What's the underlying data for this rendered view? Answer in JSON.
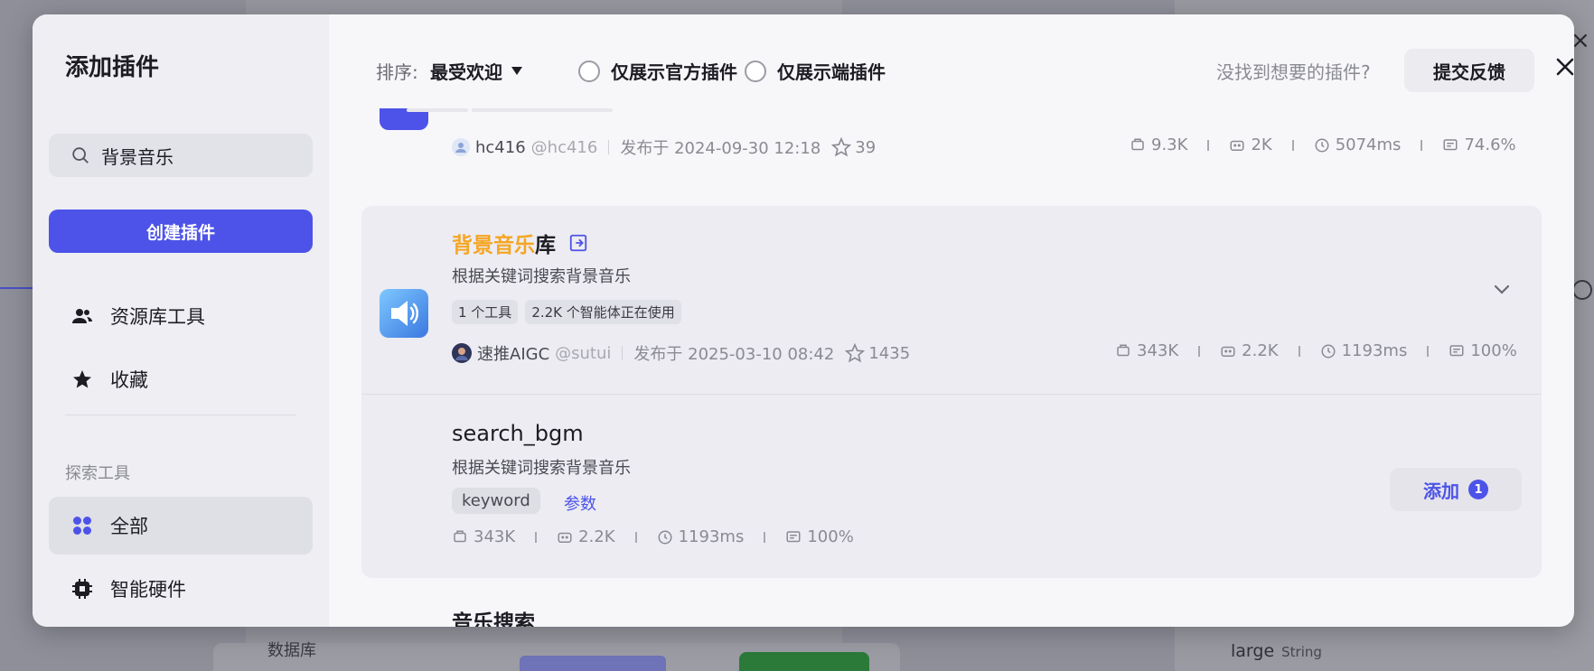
{
  "background": {
    "db_label": "数据库",
    "large_label": "large",
    "large_type": "String"
  },
  "sidebar": {
    "title": "添加插件",
    "search_value": "背景音乐",
    "create_button": "创建插件",
    "nav": [
      {
        "label": "资源库工具",
        "icon": "users-icon"
      },
      {
        "label": "收藏",
        "icon": "star-icon"
      }
    ],
    "section_label": "探索工具",
    "explore": [
      {
        "label": "全部",
        "icon": "grid-icon",
        "active": true
      },
      {
        "label": "智能硬件",
        "icon": "chip-icon"
      }
    ]
  },
  "topbar": {
    "sort_label": "排序:",
    "sort_value": "最受欢迎",
    "filter_official": "仅展示官方插件",
    "filter_device": "仅展示端插件",
    "feedback_prompt": "没找到想要的插件?",
    "feedback_button": "提交反馈"
  },
  "prev_plugin": {
    "author": "hc416",
    "handle": "@hc416",
    "published": "发布于 2024-09-30 12:18",
    "stars": "39",
    "stats": {
      "calls": "9.3K",
      "bots": "2K",
      "latency": "5074ms",
      "success": "74.6%"
    }
  },
  "plugin": {
    "title_highlight": "背景音乐",
    "title_rest": "库",
    "description": "根据关键词搜索背景音乐",
    "tags": [
      "1 个工具",
      "2.2K 个智能体正在使用"
    ],
    "author": "速推AIGC",
    "handle": "@sutui",
    "published": "发布于 2025-03-10 08:42",
    "stars": "1435",
    "stats": {
      "calls": "343K",
      "bots": "2.2K",
      "latency": "1193ms",
      "success": "100%"
    },
    "tool": {
      "name": "search_bgm",
      "description": "根据关键词搜索背景音乐",
      "param": "keyword",
      "param_link": "参数",
      "add_label": "添加",
      "add_count": "1",
      "stats": {
        "calls": "343K",
        "bots": "2.2K",
        "latency": "1193ms",
        "success": "100%"
      }
    }
  },
  "next_plugin": {
    "title": "音乐搜索"
  },
  "colors": {
    "primary": "#4d53e8",
    "highlight": "#f5a623"
  }
}
